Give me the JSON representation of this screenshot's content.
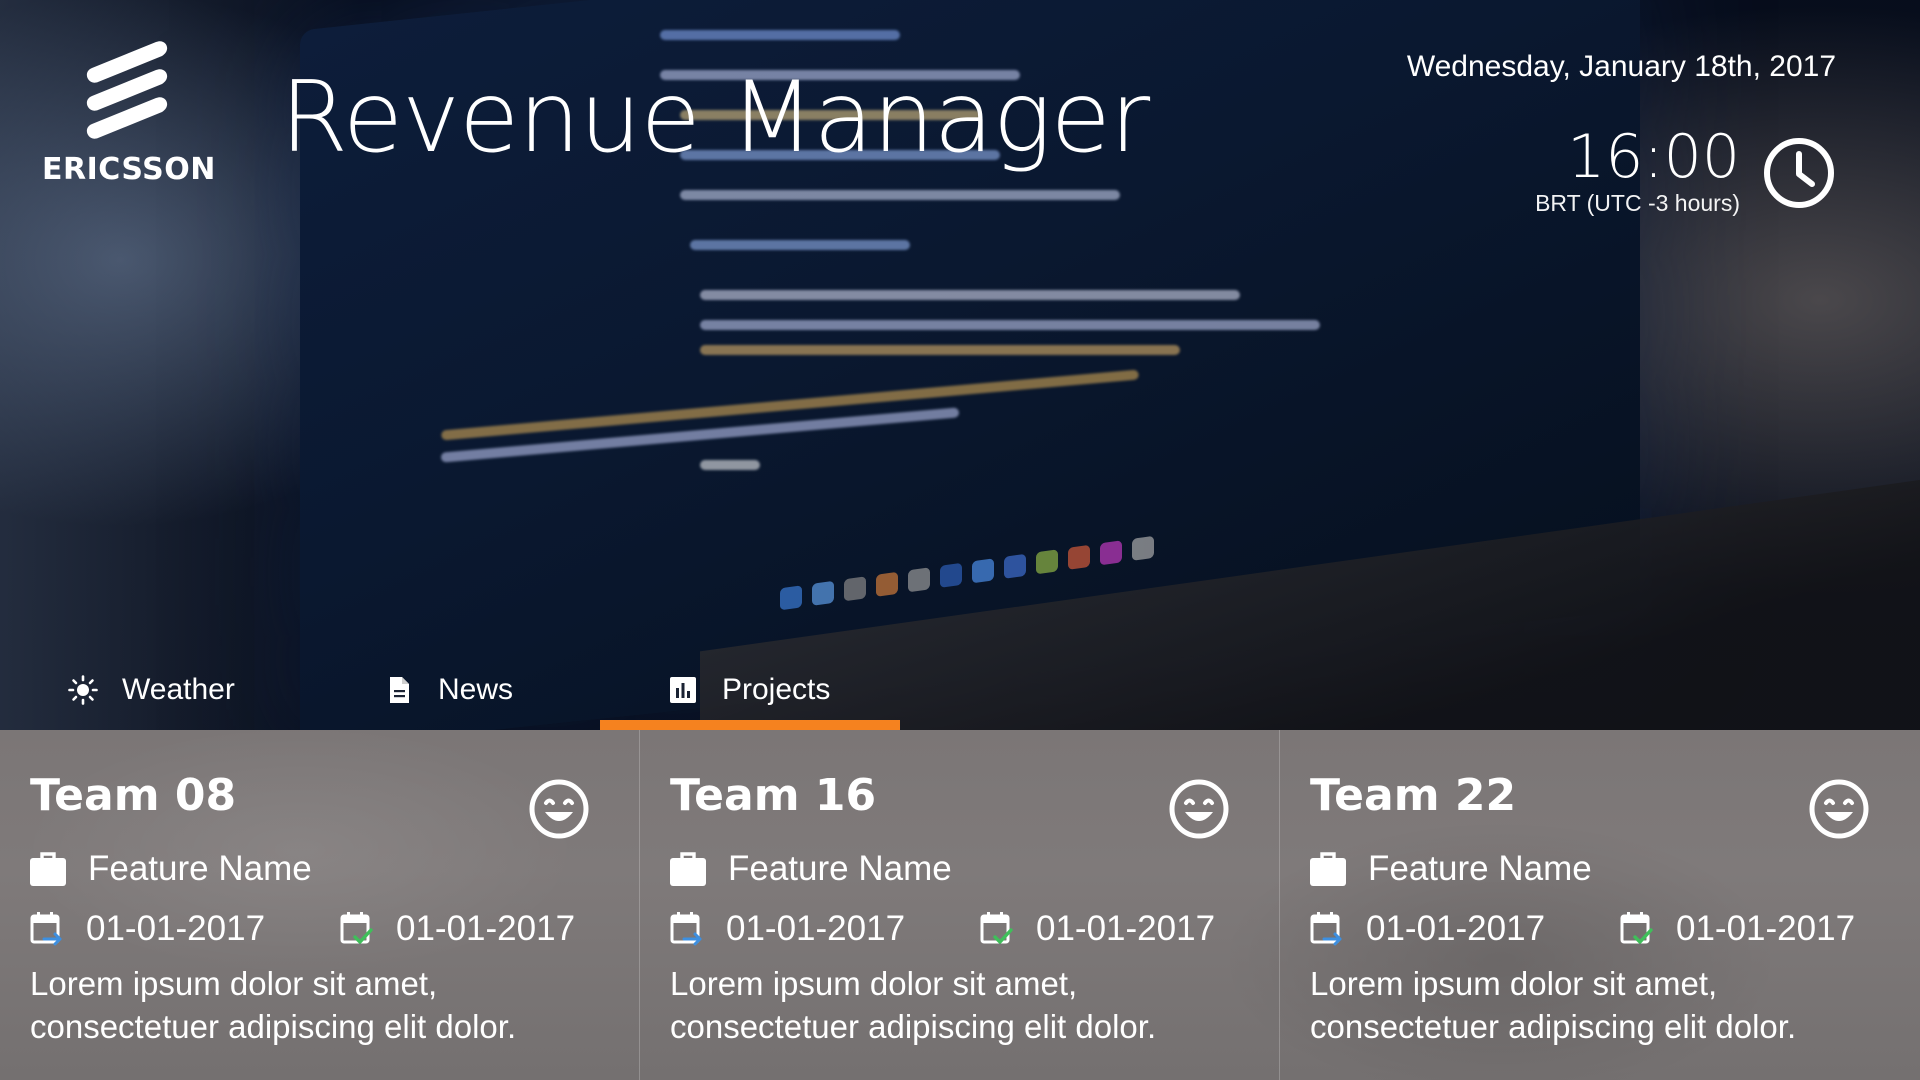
{
  "brand": {
    "logo_text": "ERICSSON"
  },
  "header": {
    "app_title": "Revenue Manager",
    "date": "Wednesday, January 18th, 2017",
    "time": "16:00",
    "timezone": "BRT (UTC -3 hours)"
  },
  "tabs": [
    {
      "label": "Weather",
      "icon": "sun-icon",
      "active": false
    },
    {
      "label": "News",
      "icon": "document-icon",
      "active": false
    },
    {
      "label": "Projects",
      "icon": "bar-chart-icon",
      "active": true
    }
  ],
  "colors": {
    "accent": "#f5821f",
    "start_date_arrow": "#3d8fe0",
    "end_date_check": "#3fbf5a"
  },
  "projects": [
    {
      "team": "Team 08",
      "status_icon": "happy-face-icon",
      "feature": "Feature Name",
      "start_date": "01-01-2017",
      "end_date": "01-01-2017",
      "description": "Lorem ipsum dolor sit amet, consectetuer adipiscing elit dolor."
    },
    {
      "team": "Team 16",
      "status_icon": "happy-face-icon",
      "feature": "Feature Name",
      "start_date": "01-01-2017",
      "end_date": "01-01-2017",
      "description": "Lorem ipsum dolor sit amet, consectetuer adipiscing elit dolor."
    },
    {
      "team": "Team 22",
      "status_icon": "happy-face-icon",
      "feature": "Feature Name",
      "start_date": "01-01-2017",
      "end_date": "01-01-2017",
      "description": "Lorem ipsum dolor sit amet, consectetuer adipiscing elit dolor."
    }
  ]
}
